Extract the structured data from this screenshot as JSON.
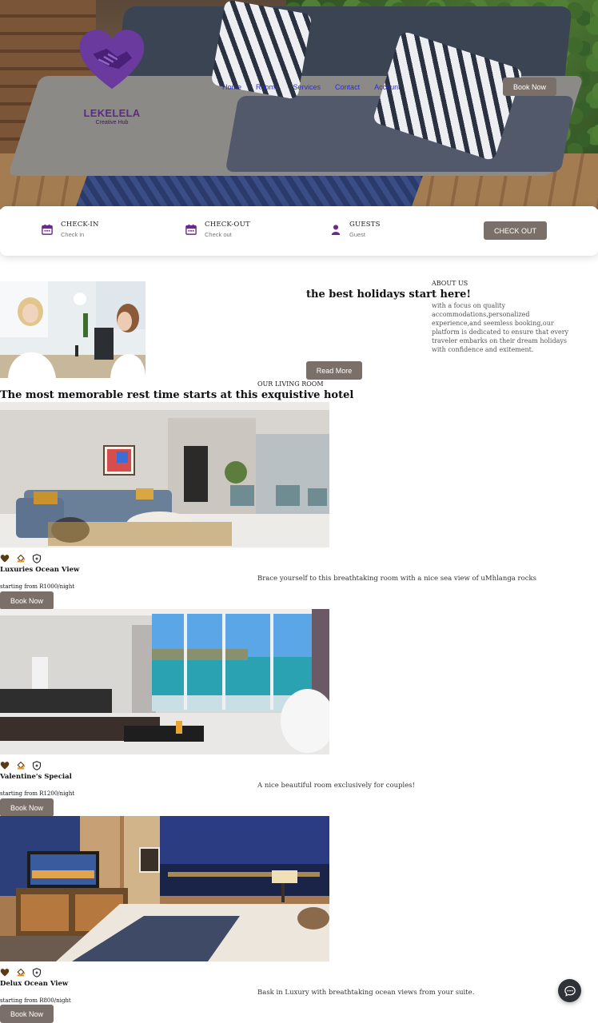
{
  "header": {
    "brand": "LEKELELA",
    "tagline": "Creative Hub",
    "nav": [
      "Home",
      "Rooms",
      "Services",
      "Contact",
      "Account"
    ],
    "book_now": "Book Now"
  },
  "booking": {
    "check_in": {
      "label": "CHECK-IN",
      "sub": "Check in"
    },
    "check_out": {
      "label": "CHECK-OUT",
      "sub": "Check out"
    },
    "guests": {
      "label": "GUESTS",
      "sub": "Guest"
    },
    "button": "CHECK OUT"
  },
  "about": {
    "label": "ABOUT US",
    "heading": "the best holidays start here!",
    "text": "with a focus on quality accommodations,personalized experience,and seemless booking,our platform is dedicated to ensure that every traveler embarks on their dream holidays with confidence and exitement.",
    "button": "Read More"
  },
  "living": {
    "label": "OUR LIVING ROOM",
    "heading": "The most memorable rest time starts at this exquistive hotel"
  },
  "rooms": [
    {
      "name": "Luxuries Ocean View",
      "price": "starting from R1000/night",
      "description": "Brace yourself to this breathtaking room with a nice sea view of uMhlanga rocks",
      "button": "Book Now"
    },
    {
      "name": "Valentine's Special",
      "price": "starting from R1200/night",
      "description": "A nice beautiful room exclusively for couples!",
      "button": "Book Now"
    },
    {
      "name": "Delux Ocean View",
      "price": "starting from R800/night",
      "description": "Bask in Luxury with breathtaking ocean views from your suite.",
      "button": "Book Now"
    }
  ],
  "colors": {
    "accent": "#5b2a86",
    "button": "#7b7069",
    "nav_link": "#2b2bd8"
  },
  "icons": {
    "room_features": [
      "heart-icon",
      "paint-bucket-icon",
      "shield-icon"
    ],
    "chat": "chat-bubble-icon"
  }
}
